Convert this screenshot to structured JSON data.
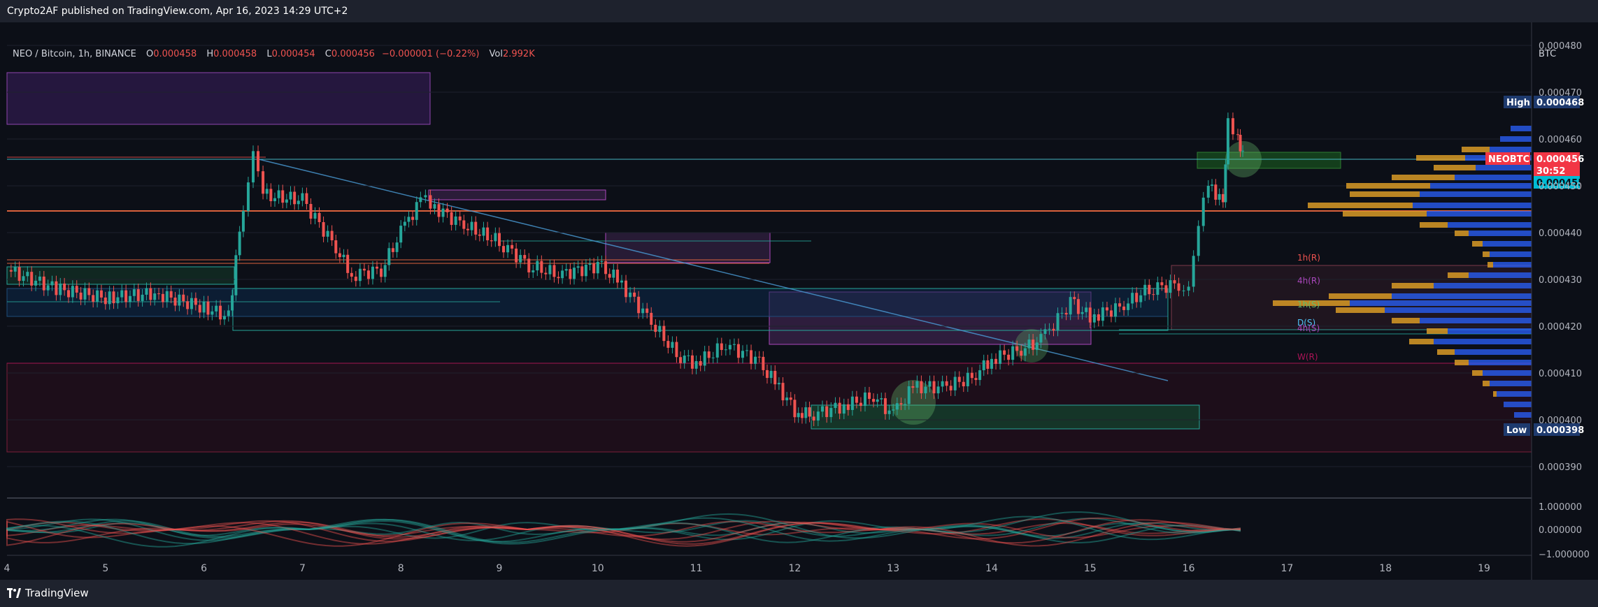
{
  "header": {
    "published": "Crypto2AF published on TradingView.com, Apr 16, 2023 14:29 UTC+2"
  },
  "legend": {
    "symbol": "NEO / Bitcoin, 1h, BINANCE",
    "open_label": "O",
    "open": "0.000458",
    "high_label": "H",
    "high": "0.000458",
    "low_label": "L",
    "low": "0.000454",
    "close_label": "C",
    "close": "0.000456",
    "change": "−0.000001 (−0.22%)",
    "vol_label": "Vol",
    "vol": "2.992K"
  },
  "axis": {
    "unit": "BTC"
  },
  "price_labels": {
    "high_tag": "High",
    "high_value": "0.000468",
    "low_tag": "Low",
    "low_value": "0.000398",
    "symbol_tag": "NEOBTC",
    "last_value": "0.000456",
    "countdown": "30:52",
    "poc_value": "0.000455"
  },
  "level_labels": [
    "1h(R)",
    "4h(R)",
    "1h(S)",
    "D(S)",
    "4h(S)",
    "W(R)"
  ],
  "footer": {
    "brand": "TradingView"
  },
  "colors": {
    "bg": "#131722",
    "up": "#26a69a",
    "down": "#ef5350",
    "zone_purple": "#6a2fa0",
    "zone_green": "#1b5e20",
    "volume_profile_blue": "#2962ff",
    "volume_profile_orange": "#d99a26"
  },
  "chart_data": [
    {
      "type": "candlestick",
      "title": "NEO / Bitcoin, 1h, BINANCE",
      "ylabel": "BTC",
      "ylim": [
        0.000384,
        0.000482
      ],
      "y_ticks": [
        "0.000390",
        "0.000400",
        "0.000410",
        "0.000420",
        "0.000430",
        "0.000440",
        "0.000450",
        "0.000460",
        "0.000470",
        "0.000480"
      ],
      "x_ticks": [
        "4",
        "5",
        "6",
        "7",
        "8",
        "9",
        "10",
        "11",
        "12",
        "13",
        "14",
        "15",
        "16",
        "17",
        "18",
        "19"
      ],
      "x_unit": "day of April 2023",
      "series": [
        {
          "name": "NEOBTC",
          "x": [
            4.0,
            4.5,
            5.0,
            5.5,
            6.0,
            6.25,
            6.4,
            6.5,
            6.6,
            7.0,
            7.3,
            7.5,
            7.8,
            8.0,
            8.2,
            8.3,
            8.6,
            9.0,
            9.3,
            9.6,
            10.0,
            10.2,
            10.5,
            10.8,
            11.0,
            11.3,
            11.6,
            11.8,
            12.0,
            12.15,
            12.5,
            12.8,
            13.0,
            13.2,
            13.5,
            13.8,
            14.0,
            14.3,
            14.5,
            14.8,
            15.0,
            15.3,
            15.6,
            15.9,
            16.0,
            16.1,
            16.2,
            16.35,
            16.4,
            16.5,
            16.55
          ],
          "close": [
            0.000432,
            0.000428,
            0.000426,
            0.000427,
            0.000424,
            0.000422,
            0.000446,
            0.000456,
            0.000448,
            0.000447,
            0.000438,
            0.000431,
            0.000432,
            0.00044,
            0.000447,
            0.000446,
            0.000442,
            0.000438,
            0.000433,
            0.000431,
            0.000433,
            0.00043,
            0.000422,
            0.000414,
            0.000412,
            0.000416,
            0.000413,
            0.000408,
            0.000402,
            0.000401,
            0.000403,
            0.000405,
            0.000401,
            0.000407,
            0.000407,
            0.000409,
            0.000413,
            0.000415,
            0.000417,
            0.000425,
            0.000422,
            0.000424,
            0.000428,
            0.000429,
            0.000427,
            0.000441,
            0.000451,
            0.000446,
            0.000465,
            0.00046,
            0.000456
          ]
        }
      ]
    },
    {
      "type": "area",
      "title": "",
      "y_ticks": [
        "1.000000",
        "0.000000",
        "−1.000000"
      ],
      "ylim": [
        -1,
        1
      ]
    }
  ]
}
